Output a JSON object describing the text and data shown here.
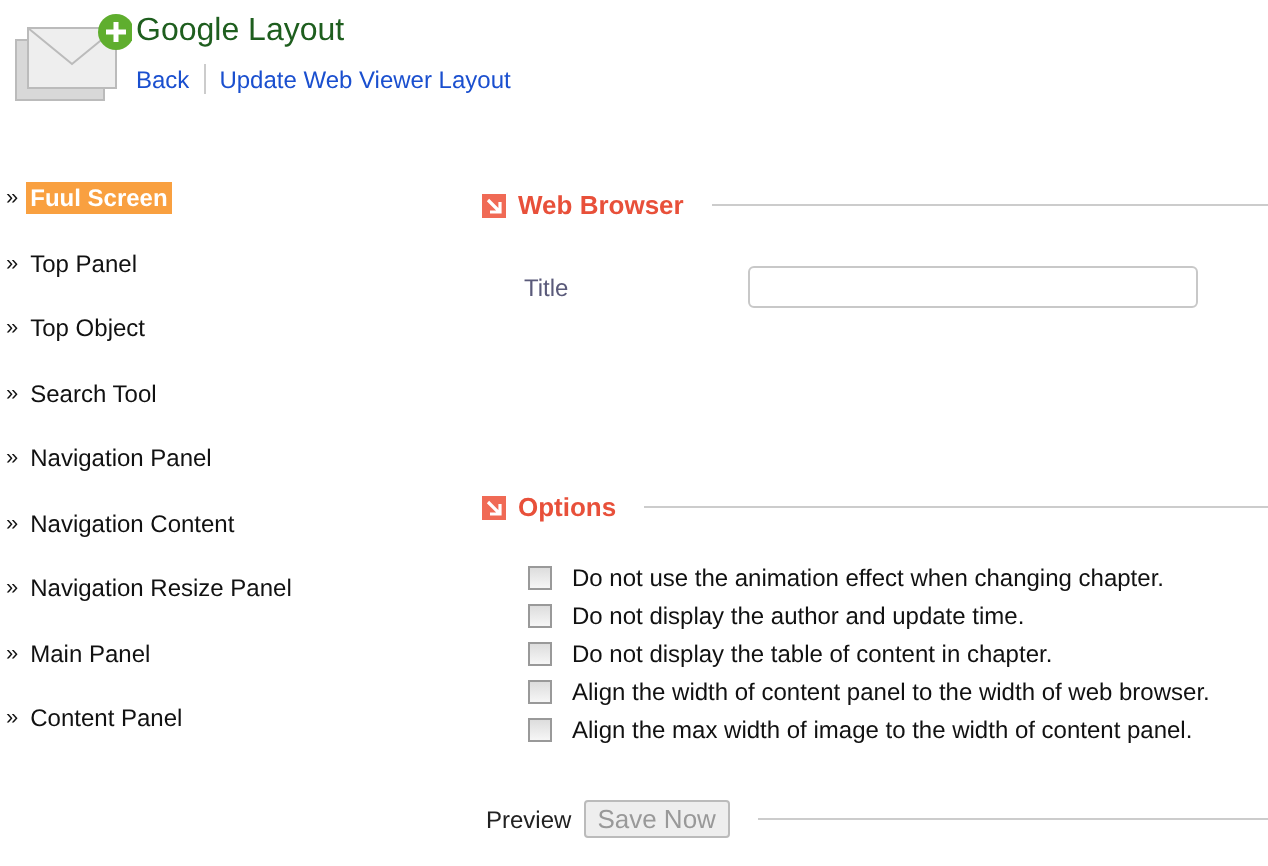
{
  "header": {
    "title": "Google Layout",
    "links": [
      "Back",
      "Update Web Viewer Layout"
    ]
  },
  "sidebar": {
    "bullet": "»",
    "items": [
      {
        "label": "Fuul Screen",
        "selected": true
      },
      {
        "label": "Top Panel",
        "selected": false
      },
      {
        "label": "Top Object",
        "selected": false
      },
      {
        "label": "Search Tool",
        "selected": false
      },
      {
        "label": "Navigation Panel",
        "selected": false
      },
      {
        "label": "Navigation Content",
        "selected": false
      },
      {
        "label": "Navigation Resize Panel",
        "selected": false
      },
      {
        "label": "Main Panel",
        "selected": false
      },
      {
        "label": "Content Panel",
        "selected": false
      }
    ]
  },
  "web_browser": {
    "heading": "Web Browser",
    "fields": [
      {
        "label": "Title"
      }
    ]
  },
  "options": {
    "heading": "Options",
    "items": [
      {
        "label": "Do not use the animation effect when changing chapter.",
        "checked": false
      },
      {
        "label": "Do not display the author and update time.",
        "checked": false
      },
      {
        "label": "Do not display the table of content in chapter.",
        "checked": false
      },
      {
        "label": "Align the width of content panel to the width of web browser.",
        "checked": false
      },
      {
        "label": "Align the max width of image to the width of content panel.",
        "checked": false
      }
    ]
  },
  "footer": {
    "preview_label": "Preview",
    "button": {
      "label": "Save Now",
      "disabled": true
    }
  }
}
